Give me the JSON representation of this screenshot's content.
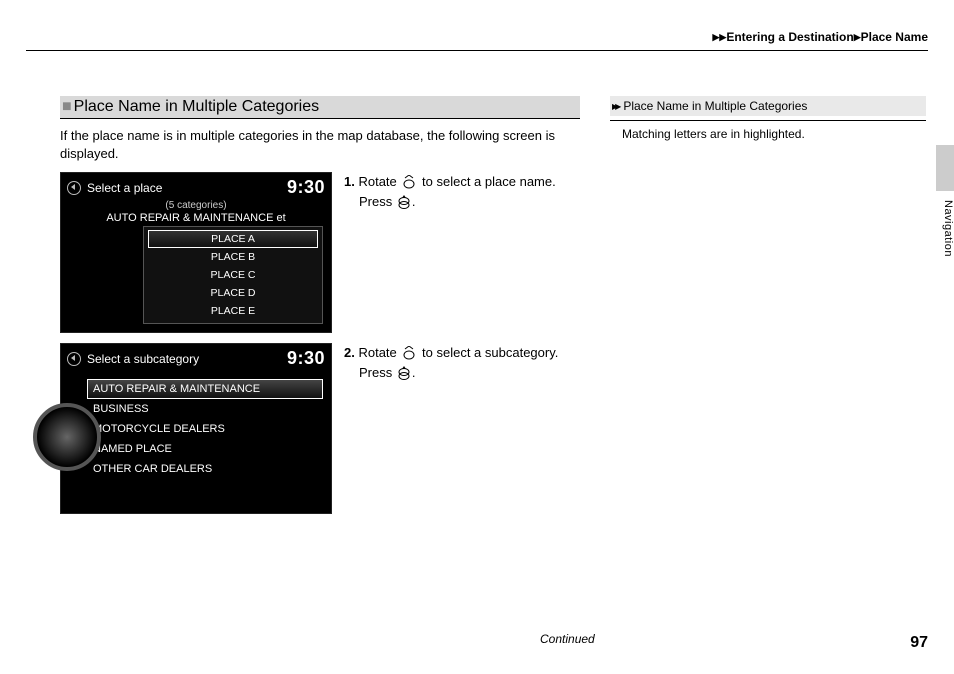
{
  "breadcrumb": {
    "level1": "Entering a Destination",
    "level2": "Place Name"
  },
  "section_title": "Place Name in Multiple Categories",
  "intro_text": "If the place name is in multiple categories in the map database, the following screen is displayed.",
  "panel1": {
    "title_bar": "Select a place",
    "clock": "9:30",
    "categories_count": "(5 categories)",
    "categories_name": "AUTO REPAIR & MAINTENANCE et",
    "items": [
      "PLACE A",
      "PLACE B",
      "PLACE C",
      "PLACE D",
      "PLACE E"
    ]
  },
  "panel2": {
    "title_bar": "Select a subcategory",
    "clock": "9:30",
    "items": [
      "AUTO REPAIR & MAINTENANCE",
      "BUSINESS",
      "MOTORCYCLE DEALERS",
      "NAMED PLACE",
      "OTHER CAR DEALERS"
    ]
  },
  "steps": {
    "s1": {
      "num": "1.",
      "text_a": "Rotate",
      "text_b": "to select a place name.",
      "text_c": "Press",
      "text_d": "."
    },
    "s2": {
      "num": "2.",
      "text_a": "Rotate",
      "text_b": "to select a subcategory.",
      "text_c": "Press",
      "text_d": "."
    }
  },
  "side": {
    "title": "Place Name in Multiple Categories",
    "body": "Matching letters are in highlighted.",
    "tab": "Navigation"
  },
  "footer": {
    "continued": "Continued",
    "page": "97"
  }
}
